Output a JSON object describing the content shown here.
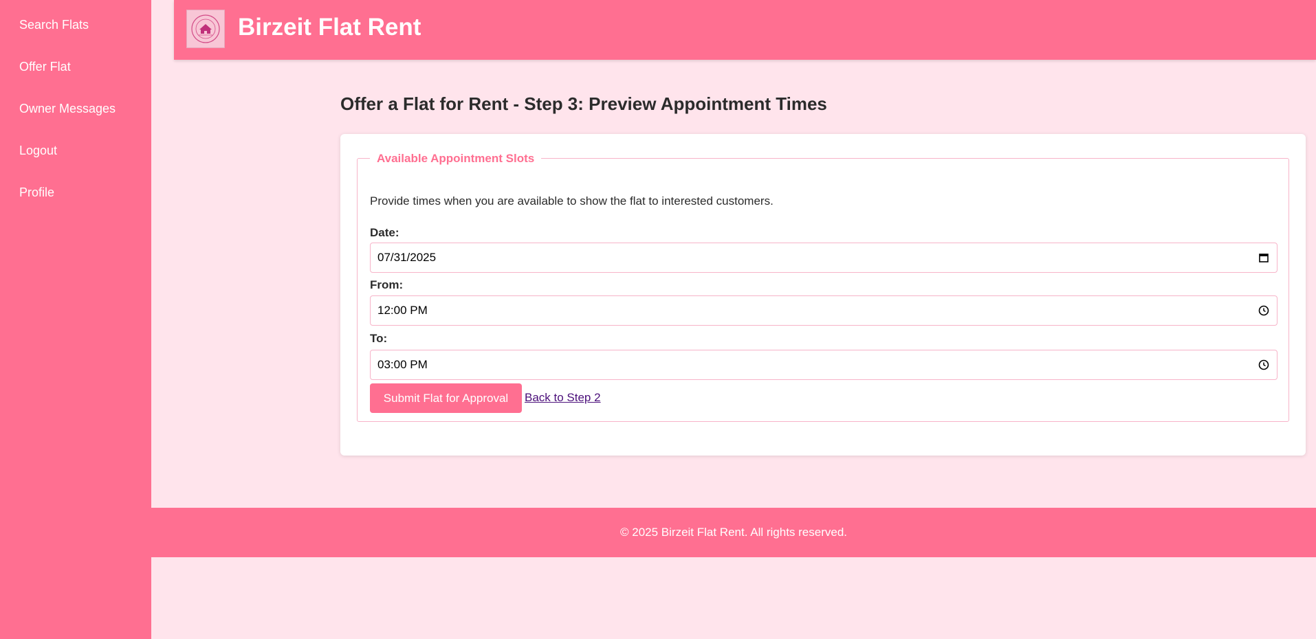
{
  "sidebar": {
    "items": [
      {
        "label": "Search Flats"
      },
      {
        "label": "Offer Flat"
      },
      {
        "label": "Owner Messages"
      },
      {
        "label": "Logout"
      },
      {
        "label": "Profile"
      }
    ]
  },
  "header": {
    "title": "Birzeit Flat Rent",
    "logo_icon": "building-seal-icon"
  },
  "main": {
    "heading": "Offer a Flat for Rent - Step 3: Preview Appointment Times",
    "fieldset": {
      "legend": "Available Appointment Slots",
      "helper_text": "Provide times when you are available to show the flat to interested customers.",
      "date": {
        "label": "Date:",
        "value": "07/31/2025",
        "icon": "calendar-icon"
      },
      "from": {
        "label": "From:",
        "value": "12:00 PM",
        "icon": "clock-icon"
      },
      "to": {
        "label": "To:",
        "value": "03:00 PM",
        "icon": "clock-icon"
      }
    },
    "submit_label": "Submit Flat for Approval",
    "back_link": "Back to Step 2"
  },
  "footer": {
    "text": "© 2025 Birzeit Flat Rent. All rights reserved."
  },
  "colors": {
    "accent": "#ff6f91",
    "background": "#ffe4ec",
    "link": "#4b0f7a"
  }
}
